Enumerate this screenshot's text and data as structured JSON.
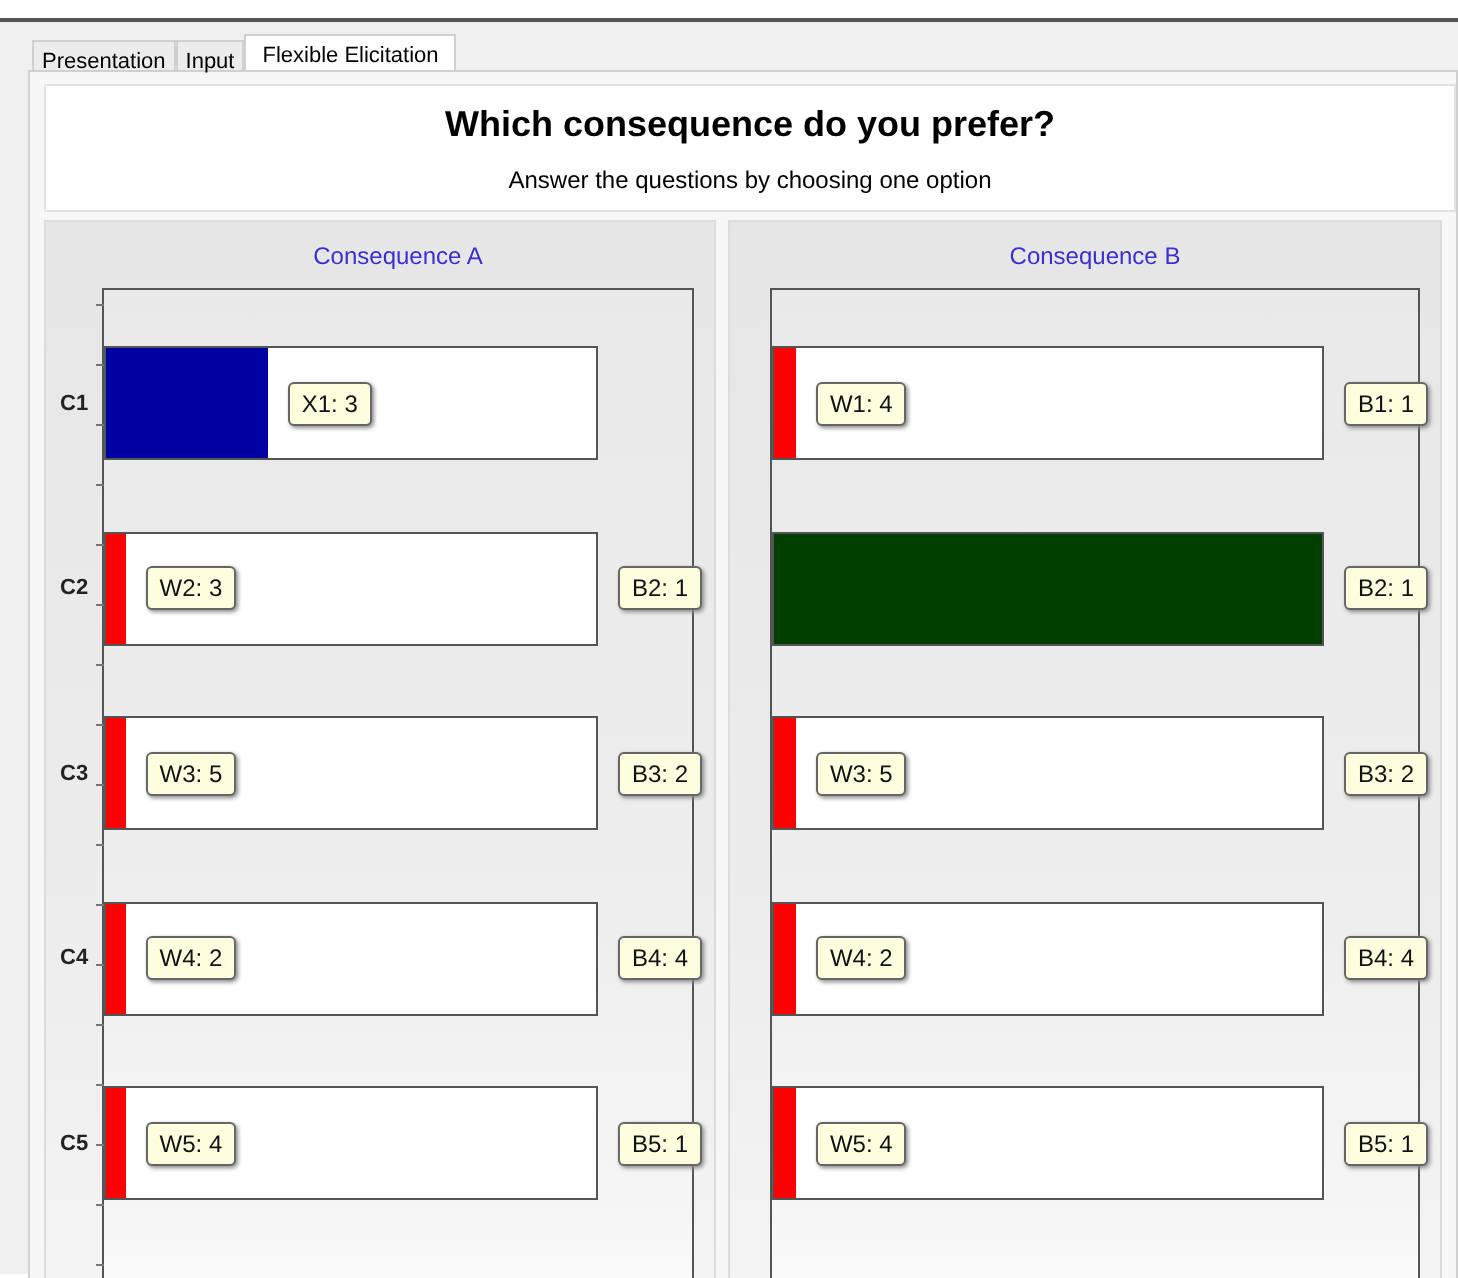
{
  "tabs": [
    {
      "label": "Presentation",
      "selected": false
    },
    {
      "label": "Input",
      "selected": false
    },
    {
      "label": "Flexible Elicitation",
      "selected": true
    }
  ],
  "header": {
    "title": "Which consequence do you prefer?",
    "subtitle": "Answer the questions by choosing one option"
  },
  "panels": [
    {
      "title": "Consequence A",
      "rows": [
        {
          "axis_label": "C1",
          "level": 0.33,
          "color": "#0000a0",
          "inner_label": "X1: 3"
        },
        {
          "axis_label": "C2",
          "level": 0.04,
          "color": "#ff0000",
          "inner_label": "W2: 3",
          "outer_label": "B2: 1"
        },
        {
          "axis_label": "C3",
          "level": 0.04,
          "color": "#ff0000",
          "inner_label": "W3: 5",
          "outer_label": "B3: 2"
        },
        {
          "axis_label": "C4",
          "level": 0.04,
          "color": "#ff0000",
          "inner_label": "W4: 2",
          "outer_label": "B4: 4"
        },
        {
          "axis_label": "C5",
          "level": 0.04,
          "color": "#ff0000",
          "inner_label": "W5: 4",
          "outer_label": "B5: 1"
        }
      ]
    },
    {
      "title": "Consequence B",
      "rows": [
        {
          "level": 0.04,
          "color": "#ff0000",
          "inner_label": "W1: 4",
          "outer_label": "B1: 1"
        },
        {
          "level": 1,
          "color": "#003f00",
          "outer_label": "B2: 1"
        },
        {
          "level": 0.04,
          "color": "#ff0000",
          "inner_label": "W3: 5",
          "outer_label": "B3: 2"
        },
        {
          "level": 0.04,
          "color": "#ff0000",
          "inner_label": "W4: 2",
          "outer_label": "B4: 4"
        },
        {
          "level": 0.04,
          "color": "#ff0000",
          "inner_label": "W5: 4",
          "outer_label": "B5: 1"
        }
      ]
    }
  ]
}
